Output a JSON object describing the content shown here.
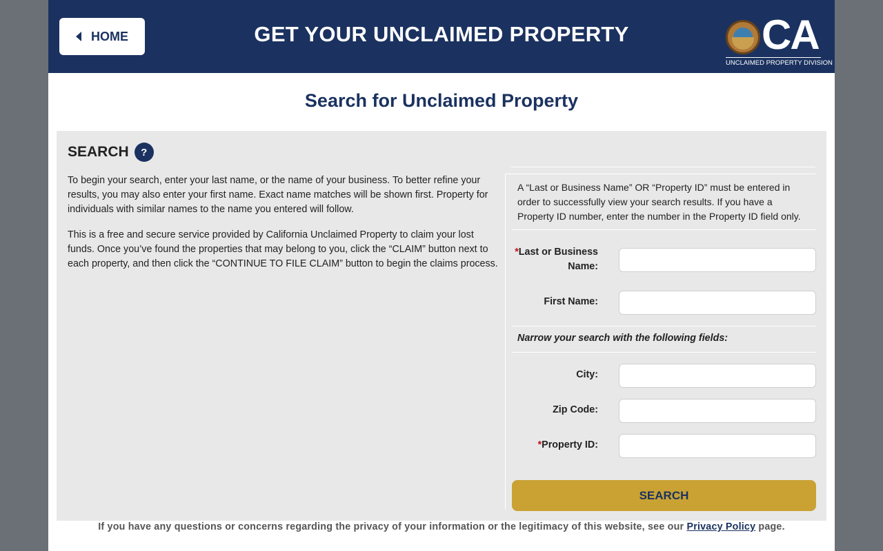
{
  "header": {
    "home_label": "HOME",
    "title": "GET YOUR UNCLAIMED PROPERTY",
    "logo_text": "CA",
    "logo_subtitle": "UNCLAIMED PROPERTY DIVISION"
  },
  "page_title": "Search for Unclaimed Property",
  "search": {
    "heading": "SEARCH",
    "help_symbol": "?",
    "intro_paragraphs": [
      "To begin your search, enter your last name, or the name of your business. To better refine your results, you may also enter your first name. Exact name matches will be shown first. Property for individuals with similar names to the name you entered will follow.",
      "This is a free and secure service provided by California Unclaimed Property to claim your lost funds. Once you’ve found the properties that may belong to you, click the “CLAIM” button next to each property, and then click the “CONTINUE TO FILE CLAIM” button to begin the claims process."
    ],
    "info_text": "A “Last or Business Name” OR “Property ID” must be entered in order to successfully view your search results. If you have a Property ID number, enter the number in the Property ID field only.",
    "required_mark": "*",
    "fields": {
      "last_name": {
        "label": "Last or Business Name:",
        "value": "",
        "placeholder": ""
      },
      "first_name": {
        "label": "First Name:",
        "value": "",
        "placeholder": ""
      },
      "city": {
        "label": "City:",
        "value": "",
        "placeholder": ""
      },
      "zip": {
        "label": "Zip Code:",
        "value": "",
        "placeholder": ""
      },
      "property_id": {
        "label": "Property ID:",
        "value": "",
        "placeholder": ""
      }
    },
    "narrow_text": "Narrow your search with the following fields:",
    "button_label": "SEARCH"
  },
  "footer": {
    "text_before": "If you have any questions or concerns regarding the privacy of your information or the legitimacy of this website, see our ",
    "link_text": "Privacy Policy",
    "text_after": " page."
  },
  "colors": {
    "navy": "#1b3260",
    "gold": "#c9a233",
    "panel": "#e8e8e8",
    "required": "#c0101a",
    "background": "#6b7077"
  }
}
